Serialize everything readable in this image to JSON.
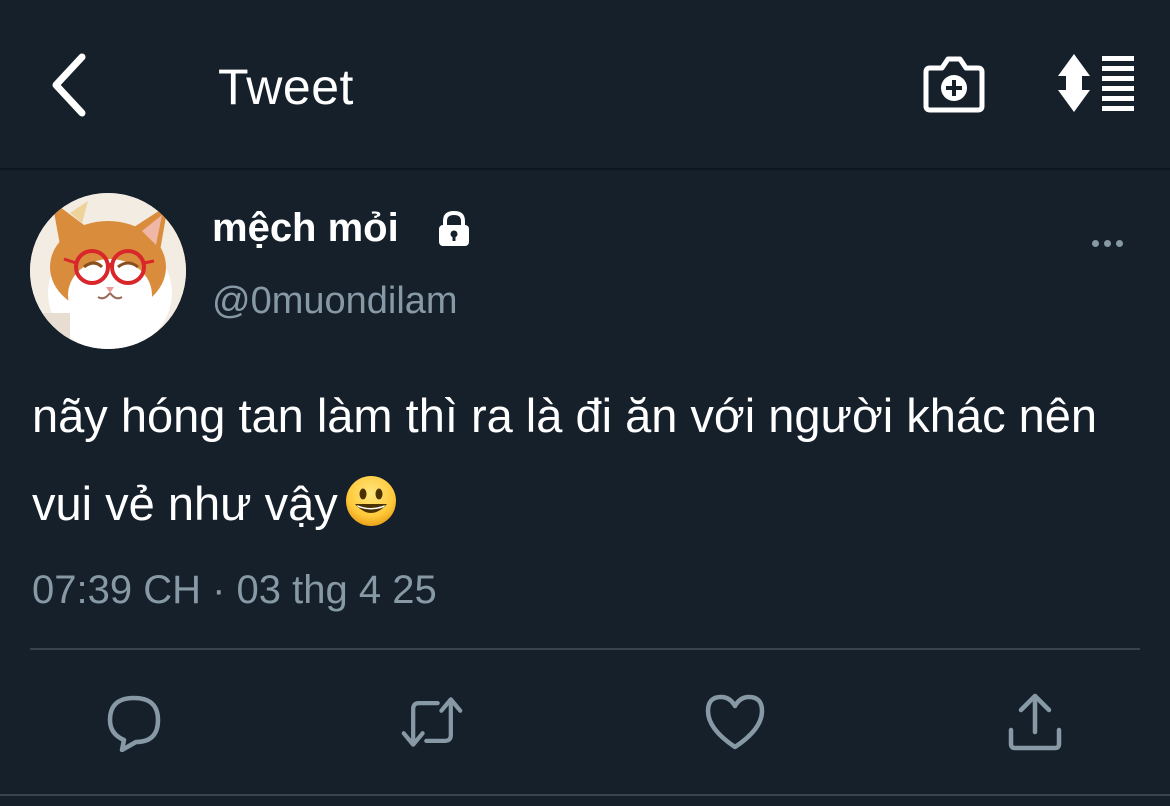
{
  "header": {
    "title": "Tweet",
    "back_icon": "chevron-left-icon",
    "camera_icon": "camera-plus-icon",
    "sort_icon": "sort-list-icon"
  },
  "tweet": {
    "display_name": "mệch mỏi",
    "protected_icon": "lock-icon",
    "handle": "@0muondilam",
    "text": "nãy hóng tan làm thì ra là đi ăn với người khác nên vui vẻ như vậy",
    "emoji": "grinning-face-emoji",
    "timestamp": "07:39 CH · 03 thg 4 25"
  },
  "actions": {
    "reply_icon": "reply-icon",
    "retweet_icon": "retweet-icon",
    "like_icon": "heart-icon",
    "share_icon": "share-icon"
  },
  "colors": {
    "background": "#15202b",
    "text_primary": "#ffffff",
    "text_secondary": "#8899a6",
    "divider": "#38444d"
  }
}
